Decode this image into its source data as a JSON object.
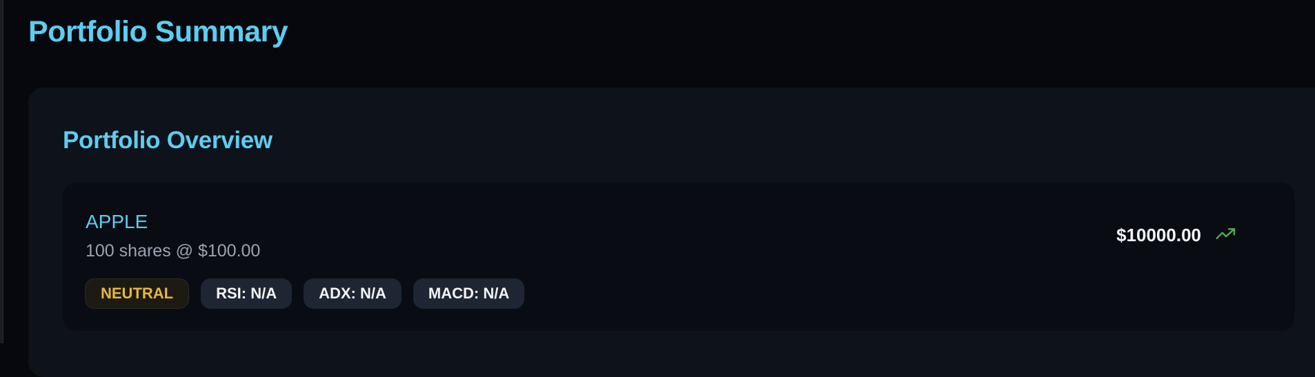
{
  "page": {
    "title": "Portfolio Summary"
  },
  "overview": {
    "title": "Portfolio Overview",
    "holdings": [
      {
        "name": "APPLE",
        "shares_text": "100 shares @ $100.00",
        "value": "$10000.00",
        "trend_icon": "trending-up-icon",
        "badges": {
          "signal": "NEUTRAL",
          "rsi": "RSI: N/A",
          "adx": "ADX: N/A",
          "macd": "MACD: N/A"
        }
      }
    ]
  },
  "colors": {
    "accent": "#5ccdf0",
    "neutral": "#e6b93a",
    "trend_up": "#4caf50"
  }
}
